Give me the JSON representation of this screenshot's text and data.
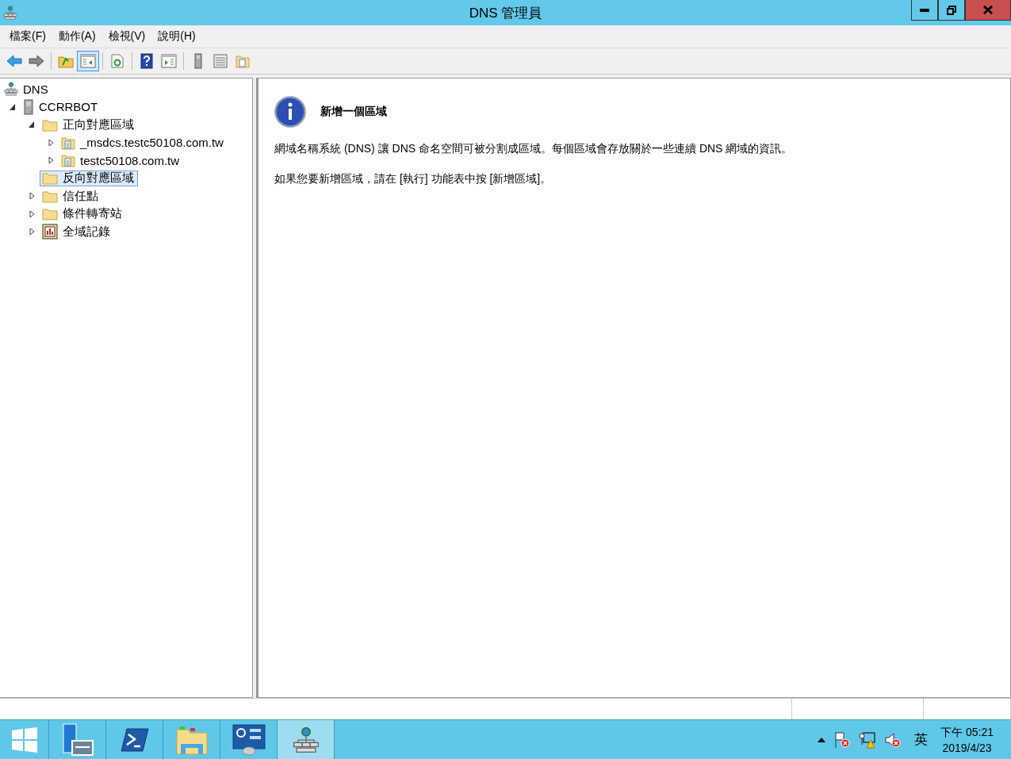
{
  "window": {
    "title": "DNS 管理員"
  },
  "menu": [
    "檔案(F)",
    "動作(A)",
    "檢視(V)",
    "說明(H)"
  ],
  "toolbar": [
    {
      "kind": "back",
      "pressed": false
    },
    {
      "kind": "forward",
      "pressed": false
    },
    {
      "kind": "sep"
    },
    {
      "kind": "up",
      "pressed": false
    },
    {
      "kind": "tree",
      "pressed": true
    },
    {
      "kind": "sep"
    },
    {
      "kind": "refresh",
      "pressed": false
    },
    {
      "kind": "sep"
    },
    {
      "kind": "help",
      "pressed": false
    },
    {
      "kind": "pane",
      "pressed": false
    },
    {
      "kind": "sep"
    },
    {
      "kind": "server",
      "pressed": false
    },
    {
      "kind": "list",
      "pressed": false
    },
    {
      "kind": "zone",
      "pressed": false
    }
  ],
  "tree": [
    {
      "label": "DNS",
      "kind": "root",
      "expandable": false,
      "selected": false,
      "children": [
        {
          "label": "CCRRBOT",
          "kind": "server",
          "expandable": true,
          "expanded": true,
          "selected": false,
          "children": [
            {
              "label": "正向對應區域",
              "kind": "folder",
              "expandable": true,
              "expanded": true,
              "selected": false,
              "children": [
                {
                  "label": "_msdcs.testc50108.com.tw",
                  "kind": "zone",
                  "expandable": true,
                  "expanded": false,
                  "selected": false
                },
                {
                  "label": "testc50108.com.tw",
                  "kind": "zone",
                  "expandable": true,
                  "expanded": false,
                  "selected": false
                }
              ]
            },
            {
              "label": "反向對應區域",
              "kind": "folder",
              "expandable": false,
              "selected": true
            },
            {
              "label": "信任點",
              "kind": "folder",
              "expandable": true,
              "expanded": false,
              "selected": false
            },
            {
              "label": "條件轉寄站",
              "kind": "folder",
              "expandable": true,
              "expanded": false,
              "selected": false
            },
            {
              "label": "全域記錄",
              "kind": "log",
              "expandable": true,
              "expanded": false,
              "selected": false
            }
          ]
        }
      ]
    }
  ],
  "content": {
    "heading": "新增一個區域",
    "paragraphs": [
      "網域名稱系統 (DNS) 讓 DNS 命名空間可被分割成區域。每個區域會存放關於一些連續 DNS 網域的資訊。",
      "如果您要新增區域，請在 [執行] 功能表中按 [新增區域]。"
    ]
  },
  "taskbar": {
    "apps": [
      {
        "kind": "start",
        "selected": false
      },
      {
        "kind": "server-manager",
        "selected": false
      },
      {
        "kind": "powershell",
        "selected": false
      },
      {
        "kind": "explorer",
        "selected": false
      },
      {
        "kind": "control-panel",
        "selected": false
      },
      {
        "kind": "dns",
        "selected": true
      }
    ],
    "tray": [
      {
        "kind": "show-hidden"
      },
      {
        "kind": "flag-error"
      },
      {
        "kind": "network-warning"
      },
      {
        "kind": "speaker-error"
      }
    ],
    "ime": "英",
    "time": "下午 05:21",
    "date": "2019/4/23"
  }
}
